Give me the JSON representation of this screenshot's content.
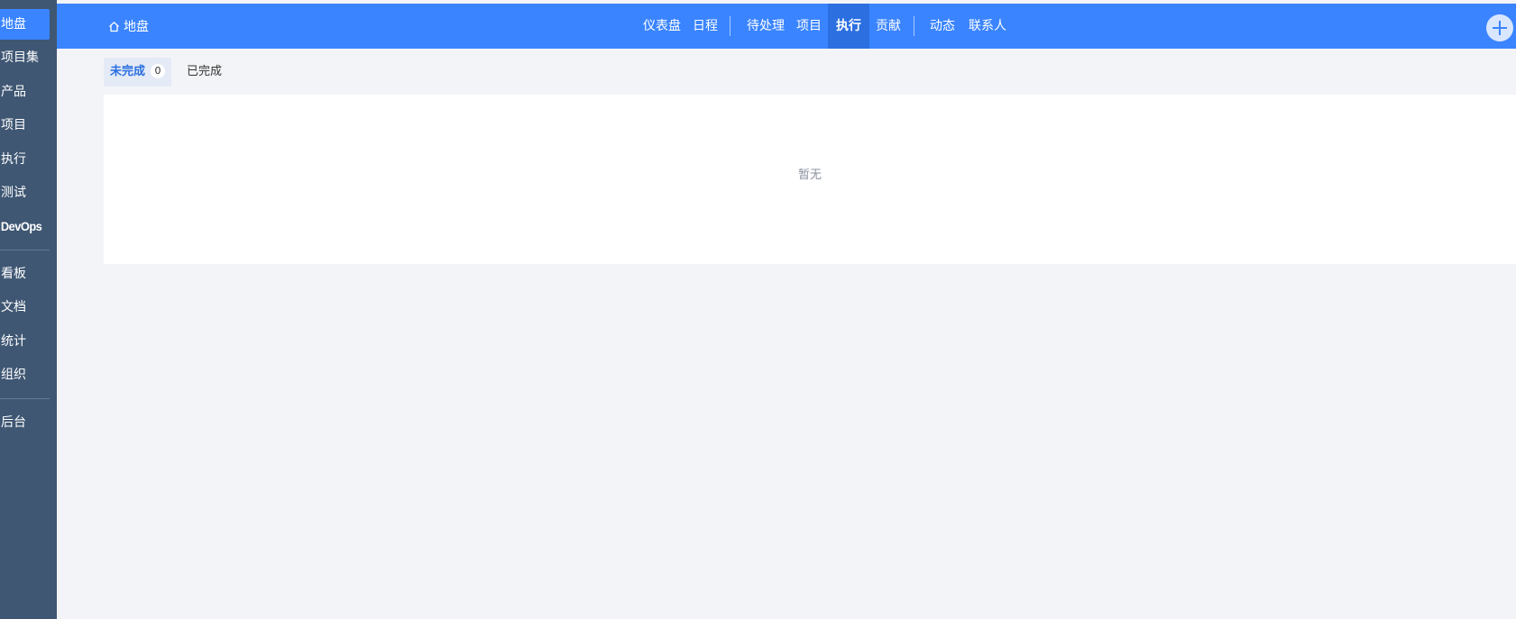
{
  "sidebar": {
    "items": [
      {
        "label": "地盘"
      },
      {
        "label": "项目集"
      },
      {
        "label": "产品"
      },
      {
        "label": "项目"
      },
      {
        "label": "执行"
      },
      {
        "label": "测试"
      },
      {
        "label": "DevOps"
      },
      {
        "label": "看板"
      },
      {
        "label": "文档"
      },
      {
        "label": "统计"
      },
      {
        "label": "组织"
      },
      {
        "label": "后台"
      }
    ],
    "active_index": 0
  },
  "header": {
    "home_label": "地盘",
    "home_icon": "home-icon",
    "nav": [
      {
        "label": "仪表盘"
      },
      {
        "label": "日程"
      },
      {
        "label": "待处理"
      },
      {
        "label": "项目"
      },
      {
        "label": "执行"
      },
      {
        "label": "贡献"
      },
      {
        "label": "动态"
      },
      {
        "label": "联系人"
      }
    ],
    "active_nav": "执行",
    "add_icon": "plus-circle-icon"
  },
  "tabs": {
    "unfinished_label": "未完成",
    "unfinished_count": "0",
    "finished_label": "已完成"
  },
  "content": {
    "empty_text": "暂无"
  },
  "colors": {
    "sidebar_bg": "#3f5773",
    "accent": "#3a84ff",
    "active_nav_bg": "#2b6fe0",
    "page_bg": "#f3f4f7"
  }
}
